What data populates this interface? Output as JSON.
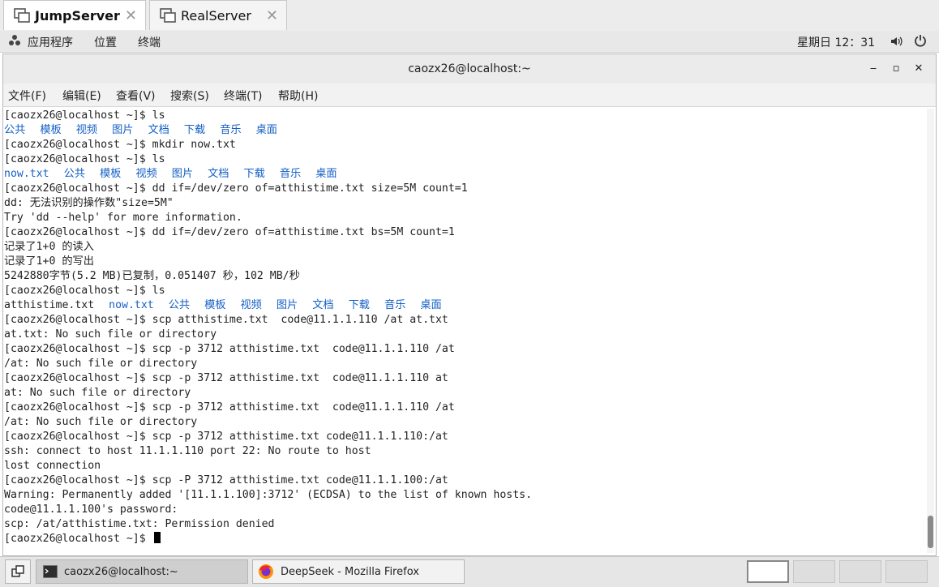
{
  "tabs": [
    {
      "label": "JumpServer",
      "active": true
    },
    {
      "label": "RealServer",
      "active": false
    }
  ],
  "panel": {
    "apps": "应用程序",
    "places": "位置",
    "terminal": "终端",
    "clock": "星期日 12：31"
  },
  "window": {
    "title": "caozx26@localhost:~",
    "controls": {
      "minimize": "‒",
      "maximize": "▫",
      "close": "✕"
    }
  },
  "menu": [
    "文件(F)",
    "编辑(E)",
    "查看(V)",
    "搜索(S)",
    "终端(T)",
    "帮助(H)"
  ],
  "prompt": "[caozx26@localhost ~]$ ",
  "terminal": {
    "l0": "ls",
    "dirs_a": [
      "公共",
      "模板",
      "视频",
      "图片",
      "文档",
      "下载",
      "音乐",
      "桌面"
    ],
    "l2": "mkdir now.txt",
    "l3": "ls",
    "dirs_b": [
      "now.txt",
      "公共",
      "模板",
      "视频",
      "图片",
      "文档",
      "下载",
      "音乐",
      "桌面"
    ],
    "l5": "dd if=/dev/zero of=atthistime.txt size=5M count=1",
    "l6": "dd: 无法识别的操作数\"size=5M\"",
    "l7": "Try 'dd --help' for more information.",
    "l8": "dd if=/dev/zero of=atthistime.txt bs=5M count=1",
    "l9": "记录了1+0 的读入",
    "l10": "记录了1+0 的写出",
    "l11": "5242880字节(5.2 MB)已复制，0.051407 秒，102 MB/秒",
    "l12": "ls",
    "l13_file": "atthistime.txt",
    "dirs_c": [
      "now.txt",
      "公共",
      "模板",
      "视频",
      "图片",
      "文档",
      "下载",
      "音乐",
      "桌面"
    ],
    "l14": "scp atthistime.txt  code@11.1.1.110 /at at.txt",
    "l15": "at.txt: No such file or directory",
    "l16": "scp -p 3712 atthistime.txt  code@11.1.1.110 /at",
    "l17": "/at: No such file or directory",
    "l18": "scp -p 3712 atthistime.txt  code@11.1.1.110 at",
    "l19": "at: No such file or directory",
    "l20": "scp -p 3712 atthistime.txt  code@11.1.1.110 /at",
    "l21": "/at: No such file or directory",
    "l22": "scp -p 3712 atthistime.txt code@11.1.1.110:/at",
    "l23": "ssh: connect to host 11.1.1.110 port 22: No route to host",
    "l24": "lost connection",
    "l25": "scp -P 3712 atthistime.txt code@11.1.1.100:/at",
    "l26": "Warning: Permanently added '[11.1.1.100]:3712' (ECDSA) to the list of known hosts.",
    "l27": "code@11.1.1.100's password:",
    "l28": "scp: /at/atthistime.txt: Permission denied",
    "l29": ""
  },
  "taskbar": {
    "terminal_task": "caozx26@localhost:~",
    "firefox_task": "DeepSeek - Mozilla Firefox"
  },
  "colors": {
    "dir_blue": "#1560c5",
    "highlight_red": "#e8231f"
  }
}
